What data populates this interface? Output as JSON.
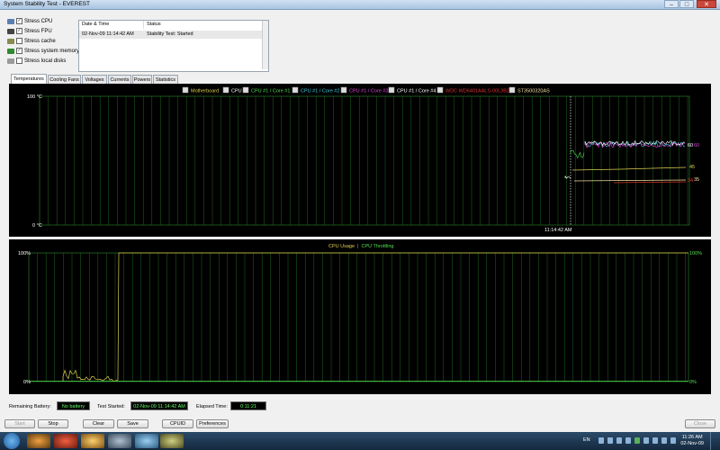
{
  "window": {
    "title": "System Stability Test - EVEREST"
  },
  "stress": [
    {
      "label": "Stress CPU",
      "checked": true,
      "icon": "cpu-icon",
      "color": "#5a7fb0"
    },
    {
      "label": "Stress FPU",
      "checked": true,
      "icon": "fpu-icon",
      "color": "#444444"
    },
    {
      "label": "Stress cache",
      "checked": false,
      "icon": "cache-icon",
      "color": "#8a8a50"
    },
    {
      "label": "Stress system memory",
      "checked": true,
      "icon": "memory-icon",
      "color": "#2f8a2f"
    },
    {
      "label": "Stress local disks",
      "checked": false,
      "icon": "disk-icon",
      "color": "#9a9a9a"
    }
  ],
  "log": {
    "headers": [
      "Date & Time",
      "Status"
    ],
    "rows": [
      {
        "time": "02-Nov-09 11:14:42 AM",
        "status": "Stability Test: Started"
      }
    ]
  },
  "tabs": [
    "Temperatures",
    "Cooling Fans",
    "Voltages",
    "Currents",
    "Powers",
    "Statistics"
  ],
  "temp_chart": {
    "legend": [
      {
        "label": "Motherboard",
        "color": "#e0d050"
      },
      {
        "label": "CPU",
        "color": "#ffffff"
      },
      {
        "label": "CPU #1 / Core #1",
        "color": "#50e050"
      },
      {
        "label": "CPU #1 / Core #2",
        "color": "#40d0e0"
      },
      {
        "label": "CPU #1 / Core #3",
        "color": "#e040e0"
      },
      {
        "label": "CPU #1 / Core #4",
        "color": "#ffffff"
      },
      {
        "label": "WDC WD6401AALS-00L3B2",
        "color": "#e03030"
      },
      {
        "label": "ST3500320AS",
        "color": "#f0e0a0"
      }
    ],
    "ymax_label": "100 °C",
    "ymin_label": "0 °C",
    "start_time": "11:14:42 AM",
    "right_values": [
      {
        "text": "60",
        "color": "#ffffff"
      },
      {
        "text": "60",
        "color": "#e040e0"
      },
      {
        "text": "45",
        "color": "#e0d050"
      },
      {
        "text": "34",
        "color": "#e03030"
      },
      {
        "text": "35",
        "color": "#f0e0a0"
      }
    ]
  },
  "usage_chart": {
    "title_a": "CPU Usage",
    "sep": "|",
    "title_b": "CPU Throttling",
    "title_a_color": "#e0d050",
    "title_b_color": "#50e050",
    "left_top": "100%",
    "left_bottom": "0%",
    "right_top": "100%",
    "right_bottom": "0%"
  },
  "footer": {
    "remaining_label": "Remaining Battery:",
    "remaining_value": "No battery",
    "started_label": "Test Started:",
    "started_value": "02-Nov-09 11:14:42 AM",
    "elapsed_label": "Elapsed Time:",
    "elapsed_value": "0:11:21"
  },
  "buttons": {
    "start": "Start",
    "stop": "Stop",
    "clear": "Clear",
    "save": "Save",
    "cpuid": "CPUID",
    "preferences": "Preferences",
    "close": "Close"
  },
  "taskbar": {
    "lang": "EN",
    "time": "11:26 AM",
    "date": "02-Nov-09"
  }
}
